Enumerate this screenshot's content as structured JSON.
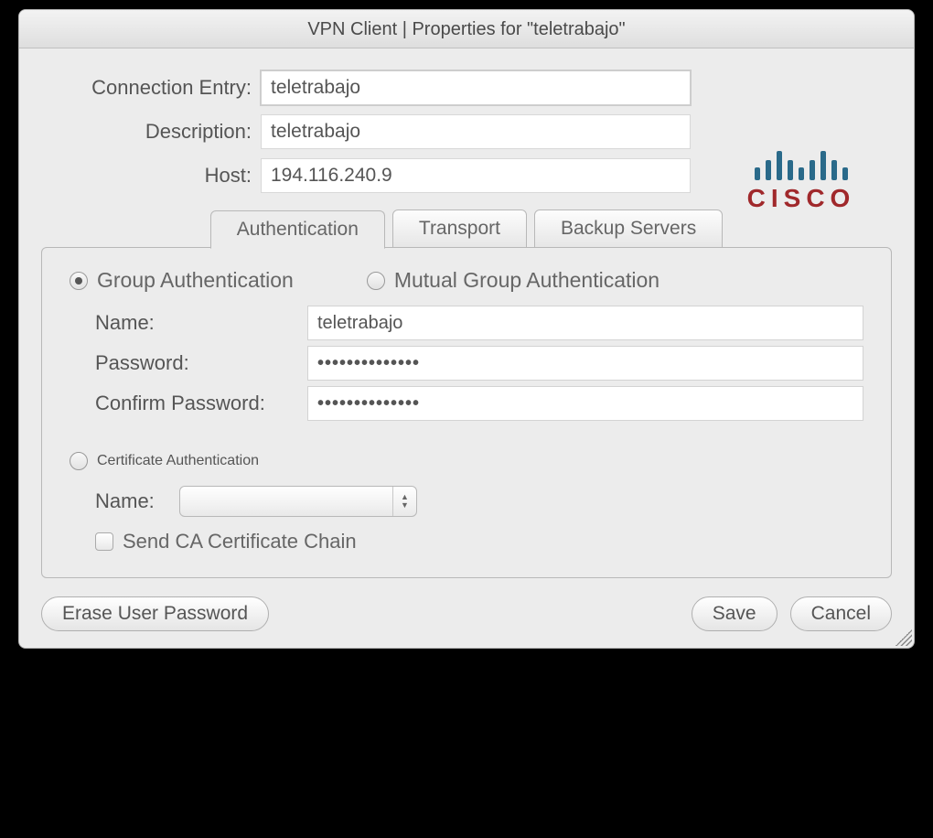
{
  "title": "VPN Client   |   Properties for \"teletrabajo\"",
  "logoText": "CISCO",
  "form": {
    "connectionEntryLabel": "Connection Entry:",
    "connectionEntryValue": "teletrabajo",
    "descriptionLabel": "Description:",
    "descriptionValue": "teletrabajo",
    "hostLabel": "Host:",
    "hostValue": "194.116.240.9"
  },
  "tabs": {
    "auth": "Authentication",
    "transport": "Transport",
    "backup": "Backup Servers"
  },
  "auth": {
    "groupRadio": "Group Authentication",
    "mutualRadio": "Mutual Group Authentication",
    "nameLabel": "Name:",
    "nameValue": "teletrabajo",
    "passwordLabel": "Password:",
    "passwordValue": "••••••••••••••",
    "confirmLabel": "Confirm Password:",
    "confirmValue": "••••••••••••••",
    "certRadio": "Certificate Authentication",
    "certNameLabel": "Name:",
    "sendCaLabel": "Send CA Certificate Chain"
  },
  "buttons": {
    "erase": "Erase User Password",
    "save": "Save",
    "cancel": "Cancel"
  }
}
